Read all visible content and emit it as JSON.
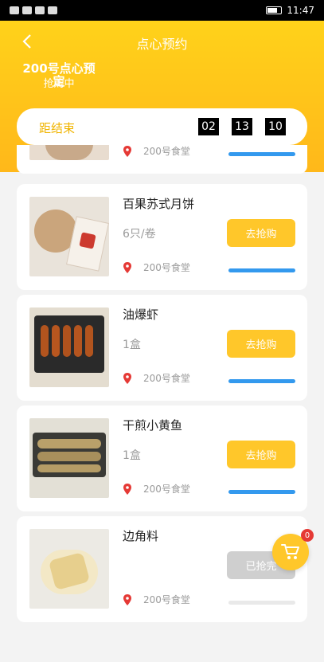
{
  "status_bar": {
    "time": "11:47"
  },
  "header": {
    "title": "点心预约",
    "subtitle": "200号点心预定",
    "status": "抢购中"
  },
  "countdown": {
    "label": "距结束",
    "hours": "02",
    "minutes": "13",
    "seconds": "10"
  },
  "items": [
    {
      "name": "",
      "spec": "",
      "location": "200号食堂",
      "button": "",
      "progress": 1.0
    },
    {
      "name": "百果苏式月饼",
      "spec": "6只/卷",
      "location": "200号食堂",
      "button": "去抢购",
      "progress": 1.0
    },
    {
      "name": "油爆虾",
      "spec": "1盒",
      "location": "200号食堂",
      "button": "去抢购",
      "progress": 1.0
    },
    {
      "name": "干煎小黄鱼",
      "spec": "1盒",
      "location": "200号食堂",
      "button": "去抢购",
      "progress": 1.0
    },
    {
      "name": "边角料",
      "spec": "",
      "location": "200号食堂",
      "button": "已抢完",
      "progress": 0
    }
  ],
  "cart": {
    "count": "0"
  },
  "colors": {
    "accent": "#ffc72a",
    "progress": "#3399ee",
    "pin": "#e53935",
    "disabled": "#cfcfcf"
  }
}
